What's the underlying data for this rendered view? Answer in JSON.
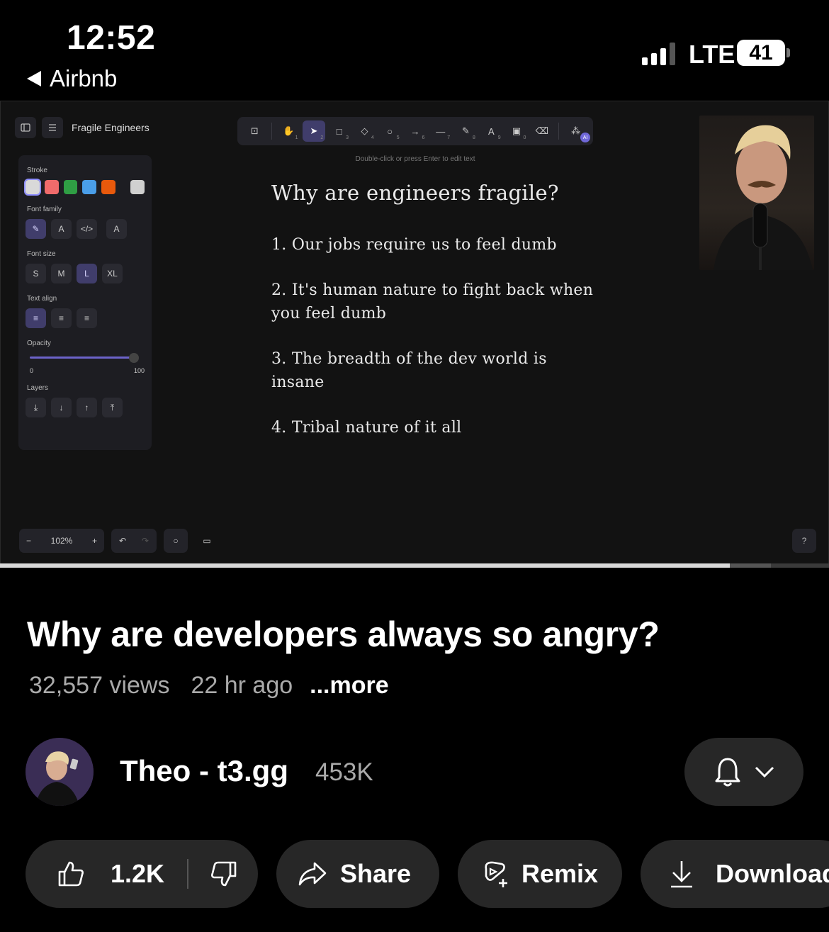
{
  "status_bar": {
    "time": "12:52",
    "back_app": "Airbnb",
    "network": "LTE",
    "battery": "41"
  },
  "video": {
    "whiteboard": {
      "file_title": "Fragile Engineers",
      "hint": "Double-click or press Enter to edit text",
      "panel": {
        "stroke_label": "Stroke",
        "stroke_colors": [
          "#d9d9d9",
          "#f06b6b",
          "#2f9e44",
          "#4a9ee8",
          "#e8590c",
          "#d0d0d0"
        ],
        "font_family_label": "Font family",
        "font_size_label": "Font size",
        "font_sizes": [
          "S",
          "M",
          "L",
          "XL"
        ],
        "text_align_label": "Text align",
        "opacity_label": "Opacity",
        "opacity_min": "0",
        "opacity_max": "100",
        "layers_label": "Layers"
      },
      "toolbar_subscripts": [
        "1",
        "2",
        "3",
        "4",
        "5",
        "6",
        "7",
        "8",
        "9",
        "0"
      ],
      "ai_badge": "AI",
      "zoom": "102%",
      "canvas": {
        "title": "Why are engineers fragile?",
        "items": [
          "1. Our jobs require us to feel dumb",
          "2. It's human nature to fight back when you feel dumb",
          "3. The breadth of the dev world is insane",
          "4. Tribal nature of it all"
        ]
      }
    },
    "progress_fraction": 0.88,
    "buffered_fraction": 0.93
  },
  "title": "Why are developers always so angry?",
  "meta": {
    "views": "32,557 views",
    "age": "22 hr ago",
    "more": "...more"
  },
  "channel": {
    "name": "Theo - t3.gg",
    "subscribers": "453K"
  },
  "actions": {
    "likes": "1.2K",
    "share": "Share",
    "remix": "Remix",
    "download": "Download"
  }
}
